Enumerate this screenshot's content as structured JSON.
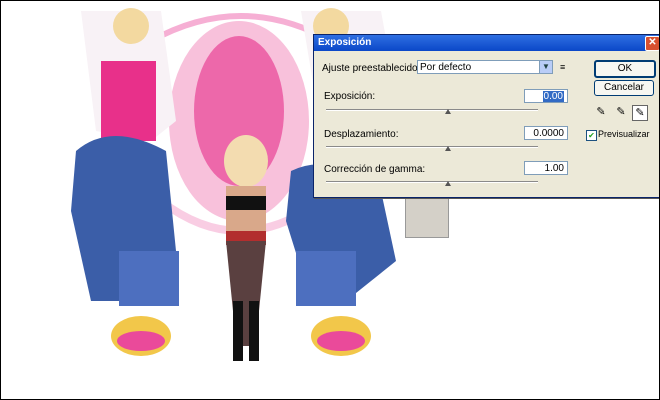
{
  "dialog": {
    "title": "Exposición",
    "preset": {
      "label": "Ajuste preestablecido:",
      "value": "Por defecto"
    },
    "fields": [
      {
        "label": "Exposición:",
        "value": "0.00",
        "slider": 0.5
      },
      {
        "label": "Desplazamiento:",
        "value": "0.0000",
        "slider": 0.5
      },
      {
        "label": "Corrección de gamma:",
        "value": "1.00",
        "slider": 0.5
      }
    ],
    "buttons": {
      "ok": "OK",
      "cancel": "Cancelar"
    },
    "preview": {
      "label": "Previsualizar",
      "checked": true
    }
  },
  "colors": {
    "accent": "#e91e8c",
    "title_bar": "#0a47c8",
    "dialog_bg": "#ece9d8"
  }
}
